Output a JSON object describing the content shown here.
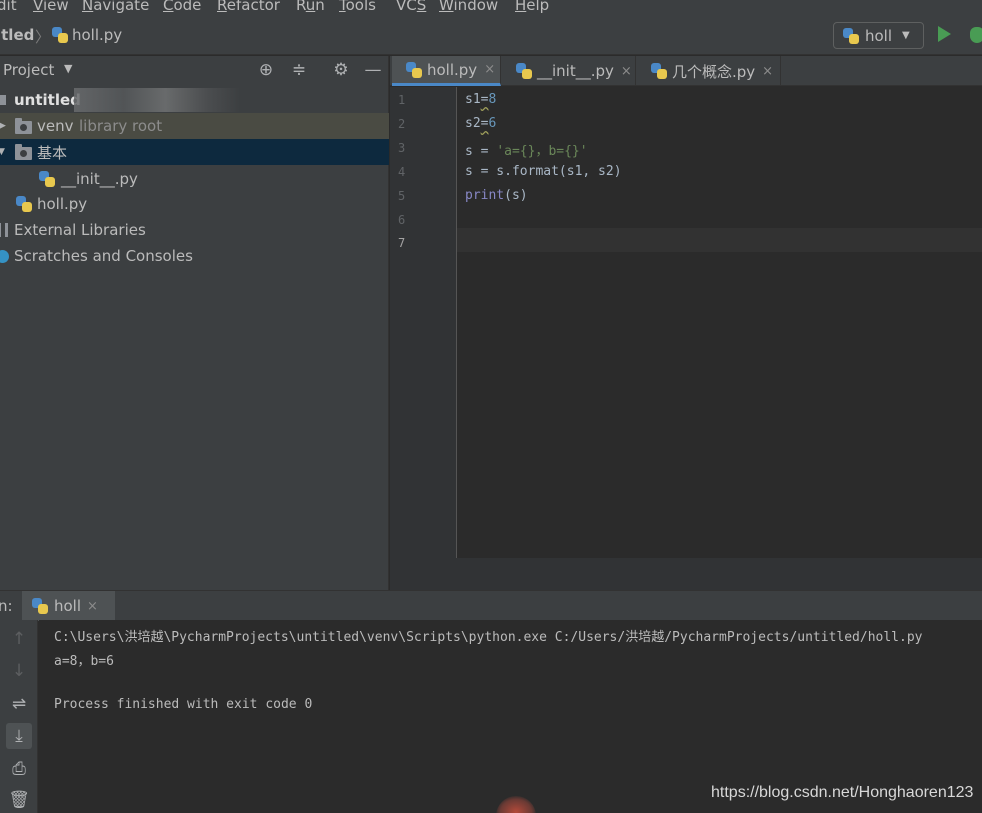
{
  "menu": {
    "items": [
      {
        "label": "dit",
        "underline": ""
      },
      {
        "label": "View",
        "underline": "V"
      },
      {
        "label": "Navigate",
        "underline": "N"
      },
      {
        "label": "Code",
        "underline": "C"
      },
      {
        "label": "Refactor",
        "underline": "R"
      },
      {
        "label": "Run",
        "underline": "u"
      },
      {
        "label": "Tools",
        "underline": "T"
      },
      {
        "label": "VCS",
        "underline": "S"
      },
      {
        "label": "Window",
        "underline": "W"
      },
      {
        "label": "Help",
        "underline": "H"
      }
    ]
  },
  "navbar": {
    "project_crumb": "itled",
    "separator": "〉",
    "file_crumb": "holl.py",
    "run_config": "holl"
  },
  "project_panel": {
    "title": "Project",
    "tree": [
      {
        "label": "untitled",
        "suffix": ""
      },
      {
        "label": "venv",
        "suffix": "library root"
      },
      {
        "label": "基本",
        "suffix": ""
      },
      {
        "label": "__init__.py",
        "suffix": ""
      },
      {
        "label": "holl.py",
        "suffix": ""
      },
      {
        "label": "External Libraries",
        "suffix": ""
      },
      {
        "label": "Scratches and Consoles",
        "suffix": ""
      }
    ]
  },
  "editor": {
    "tabs": [
      {
        "label": "holl.py",
        "close": "×"
      },
      {
        "label": "__init__.py",
        "close": "×"
      },
      {
        "label": "几个概念.py",
        "close": "×"
      }
    ],
    "line_numbers": [
      "1",
      "2",
      "3",
      "4",
      "5",
      "6",
      "7"
    ],
    "code": [
      {
        "p1": "s1",
        "p2": "=",
        "p3": "8"
      },
      {
        "p1": "s2",
        "p2": "=",
        "p3": "6"
      },
      {
        "p1": "s = ",
        "p2": "'a={}，b={}'"
      },
      {
        "p1": "s = s.format(s1, s2)"
      },
      {
        "p1": "print",
        "p2": "(s)"
      },
      {
        "p1": ""
      },
      {
        "p1": ""
      }
    ]
  },
  "run_panel": {
    "label": "n:",
    "tab": "holl",
    "tab_close": "×",
    "output": [
      "C:\\Users\\洪培越\\PycharmProjects\\untitled\\venv\\Scripts\\python.exe C:/Users/洪培越/PycharmProjects/untitled/holl.py",
      "a=8，b=6",
      "",
      "Process finished with exit code 0"
    ]
  },
  "watermark": "https://blog.csdn.net/Honghaoren123",
  "colors": {
    "accent": "#4a88c7",
    "run_green": "#499c54",
    "selection": "#0d293e",
    "string": "#6a8759",
    "number": "#6897bb"
  }
}
